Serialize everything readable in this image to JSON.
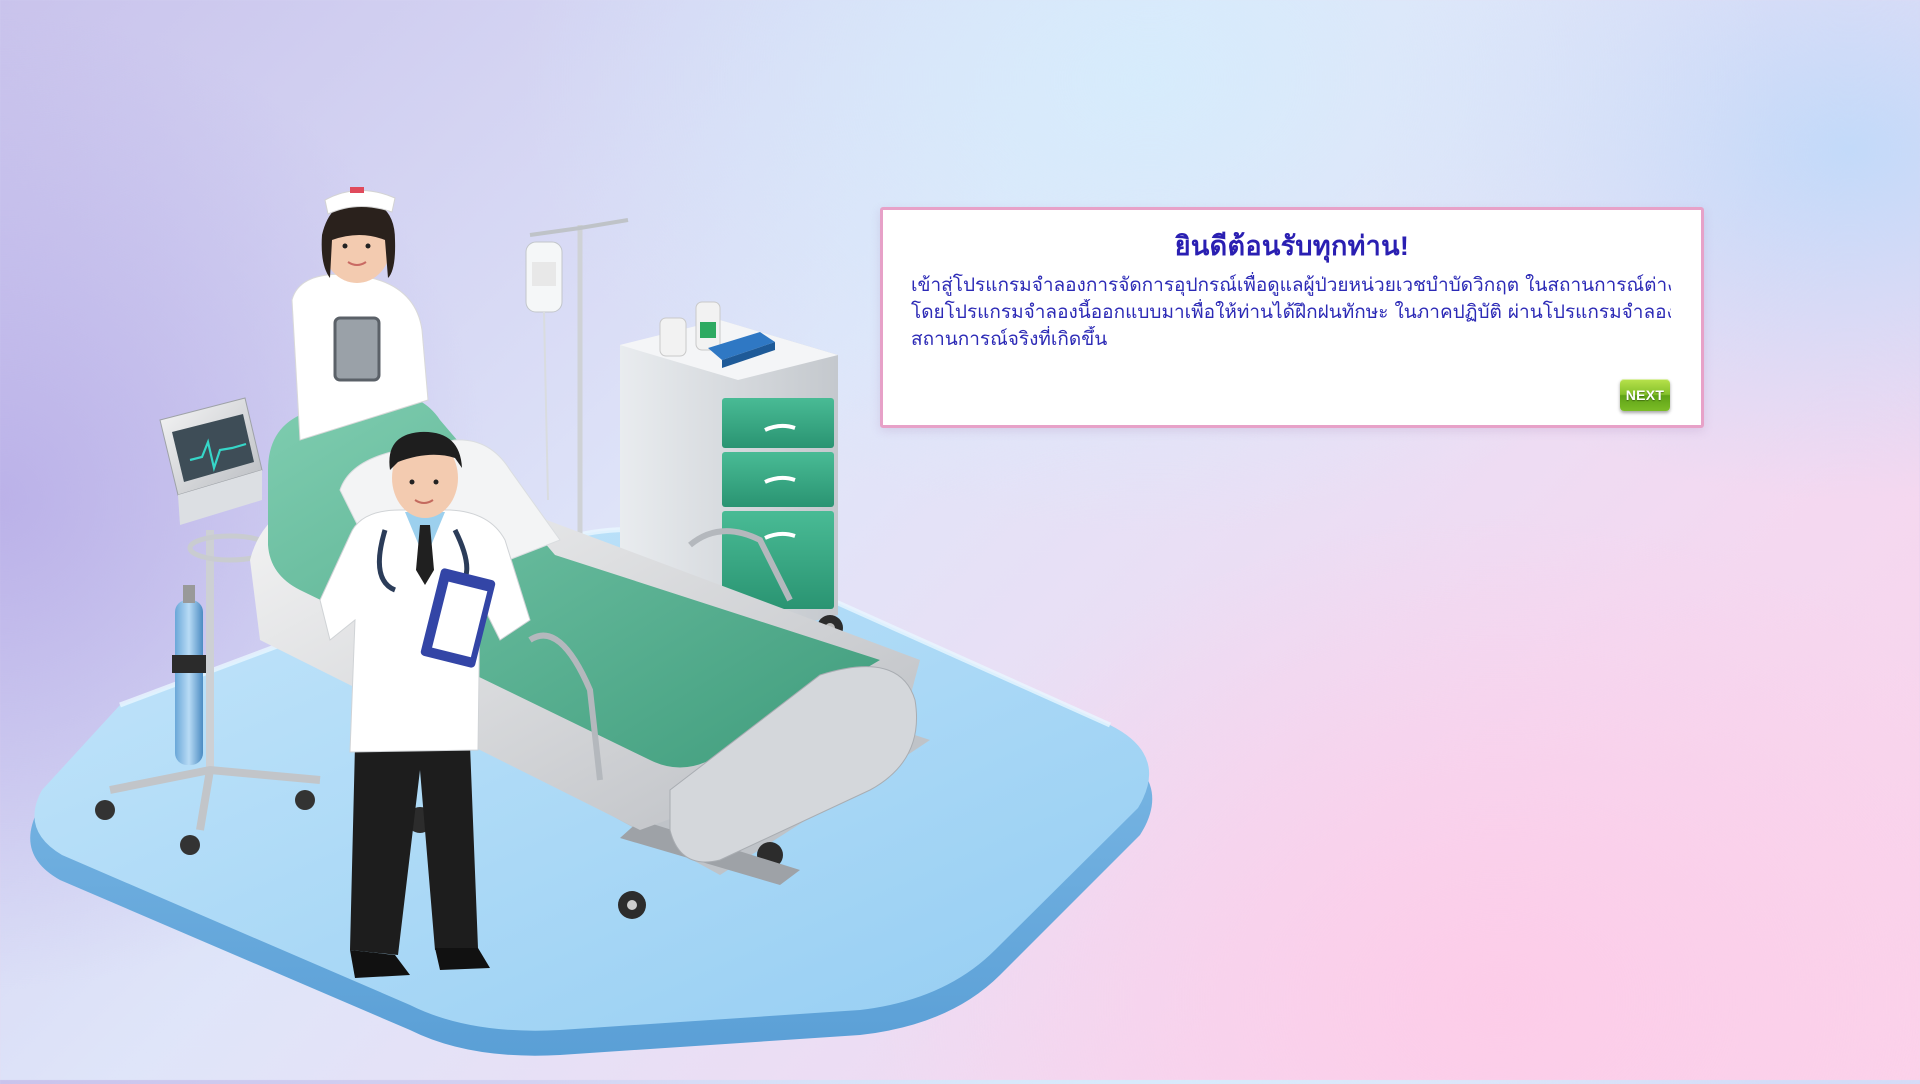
{
  "welcome": {
    "title": "ยินดีต้อนรับทุกท่าน!",
    "body_lines": [
      "เข้าสู่โปรแกรมจำลองการจัดการอุปกรณ์เพื่อดูแลผู้ป่วยหน่วยเวชบำบัดวิกฤต ในสถานการณ์ต่างๆ",
      "โดยโปรแกรมจำลองนี้ออกแบบมาเพื่อให้ท่านได้ฝึกฝนทักษะ ในภาคปฏิบัติ ผ่านโปรแกรมจำลองจาก",
      "สถานการณ์จริงที่เกิดขึ้น"
    ],
    "next_label": "NEXT"
  },
  "illustration": {
    "icons": [
      "nurse-icon",
      "doctor-icon",
      "hospital-bed-icon",
      "patient-monitor-icon",
      "iv-stand-icon",
      "bedside-cabinet-icon",
      "oxygen-tank-icon",
      "first-aid-kit-icon"
    ]
  },
  "colors": {
    "title": "#2a1fb2",
    "body_text": "#2c2ab6",
    "card_border": "#e7a1c8",
    "next_button": "#86c22b",
    "bed_mattress": "#5bb592",
    "platform": "#a9d8f6"
  }
}
